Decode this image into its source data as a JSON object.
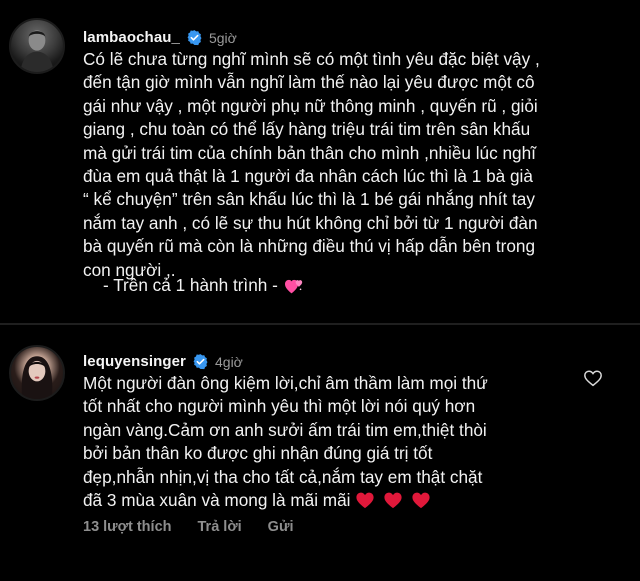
{
  "post1": {
    "username": "lambaochau_",
    "time": "5giờ",
    "lines": [
      "Có lẽ chưa từng nghĩ mình sẽ có một tình yêu đặc biệt vậy ,",
      "đến tận giờ mình vẫn nghĩ làm thế nào lại yêu được một cô",
      "gái như vậy , một người phụ nữ thông minh , quyến rũ , giỏi",
      "giang , chu toàn có thể lấy hàng triệu trái tim trên sân khấu",
      "mà gửi trái tim của chính bản thân cho mình ,nhiều lúc nghĩ",
      "đùa em quả thật là 1 người đa nhân cách lúc thì là 1 bà già",
      "“ kể chuyện”  trên sân khấu lúc thì là 1 bé gái nhắng nhít tay",
      "nắm tay anh , có lẽ sự thu hút không chỉ bởi từ 1 người đàn",
      "bà quyến rũ mà còn là những điều thú vị hấp dẫn bên trong",
      "con người ,."
    ],
    "signoff": "- Trên cả 1 hành trình -",
    "signoff_emoji": "two-hearts-emoji"
  },
  "post2": {
    "username": "lequyensinger",
    "time": "4giờ",
    "lines": [
      "Một người đàn ông kiệm lời,chỉ âm thầm làm mọi thứ",
      "tốt nhất cho người mình yêu thì một lời nói quý hơn",
      "ngàn vàng.Cảm ơn anh sưởi ấm trái tim em,thiệt thòi",
      "bởi bản thân ko được ghi nhận đúng giá trị tốt",
      "đẹp,nhẫn nhịn,vị tha cho tất cả,nắm tay em thật chặt",
      "đã 3 mùa xuân và mong là mãi mãi"
    ],
    "trailing_emoji": [
      "red-heart-emoji",
      "red-heart-emoji",
      "red-heart-emoji"
    ],
    "footer": {
      "likes": "13 lượt thích",
      "reply": "Trả lời",
      "send": "Gửi"
    },
    "like_icon": "heart-outline-icon"
  },
  "colors": {
    "background": "#000000",
    "text": "#f2f2f2",
    "muted": "#9a9a9a",
    "verified": "#3897f0",
    "red_heart": "#e0183a",
    "pink_heart": "#ff4fa3"
  }
}
